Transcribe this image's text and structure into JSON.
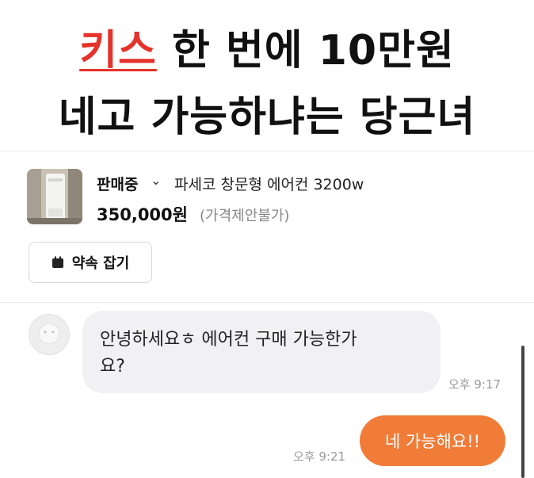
{
  "headline": {
    "line1_highlight": "키스",
    "line1_rest": " 한 번에 10만원",
    "line2": "네고 가능하냐는 당근녀"
  },
  "product": {
    "status": "판매중",
    "title": "파세코 창문형 에어컨 3200w",
    "price": "350,000원",
    "price_note": "(가격제안불가)"
  },
  "actions": {
    "appointment_label": "약속 잡기"
  },
  "messages": [
    {
      "from": "buyer",
      "text_line1": "안녕하세요ㅎ 에어컨 구매 가능한가",
      "text_line2": "요?",
      "time": "오후 9:17"
    },
    {
      "from": "seller",
      "text": "네 가능해요!!",
      "time": "오후 9:21"
    }
  ],
  "colors": {
    "accent_red": "#e5322a",
    "seller_bubble": "#f07c38",
    "buyer_bubble": "#f1f1f3"
  }
}
